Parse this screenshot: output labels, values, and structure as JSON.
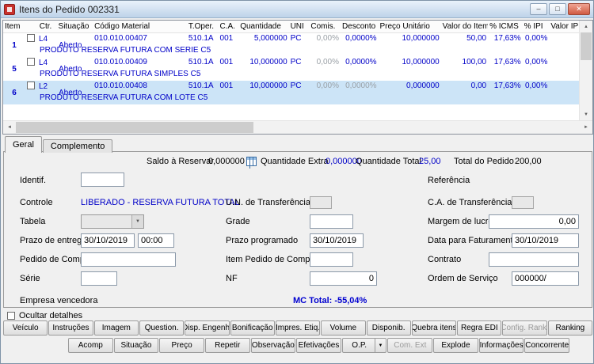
{
  "window": {
    "title": "Itens do Pedido 002331"
  },
  "icons": {
    "minimize": "–",
    "maximize": "□",
    "close": "✕",
    "scroll_up": "▲",
    "scroll_down": "▼",
    "scroll_left": "◄",
    "scroll_right": "►",
    "dropdown": "▼"
  },
  "colors": {
    "grid_text": "#0000C8",
    "selection_bg": "#CCE4F7",
    "muted_text": "#9AA0A6",
    "highlight_blue": "#0000D0"
  },
  "grid": {
    "columns": [
      "Item",
      "Ctr.",
      "Situação",
      "Código Material",
      "T.Oper.",
      "C.A.",
      "Quantidade",
      "UNI",
      "Comis.",
      "Desconto",
      "Preço Unitário",
      "Valor do Item",
      "% ICMS",
      "% IPI",
      "Valor IPI"
    ],
    "rows": [
      {
        "item": "1",
        "ctr": "L4",
        "situacao": "Aberto",
        "codigo": "010.010.00407",
        "toper": "510.1A",
        "ca": "001",
        "quantidade": "5,000000",
        "uni": "PC",
        "comis": "0,00%",
        "desconto": "0,0000%",
        "preco": "10,000000",
        "valor": "50,00",
        "icms": "17,63%",
        "ipi": "0,00%",
        "descricao": "PRODUTO RESERVA FUTURA COM SERIE C5"
      },
      {
        "item": "5",
        "ctr": "L4",
        "situacao": "Aberto",
        "codigo": "010.010.00409",
        "toper": "510.1A",
        "ca": "001",
        "quantidade": "10,000000",
        "uni": "PC",
        "comis": "0,00%",
        "desconto": "0,0000%",
        "preco": "10,000000",
        "valor": "100,00",
        "icms": "17,63%",
        "ipi": "0,00%",
        "descricao": "PRODUTO RESERVA FUTURA SIMPLES C5"
      },
      {
        "item": "6",
        "ctr": "L2",
        "situacao": "Aberto",
        "codigo": "010.010.00408",
        "toper": "510.1A",
        "ca": "001",
        "quantidade": "10,000000",
        "uni": "PC",
        "comis": "0,00%",
        "desconto": "0,0000%",
        "preco": "0,000000",
        "valor": "0,00",
        "icms": "17,63%",
        "ipi": "0,00%",
        "descricao": "PRODUTO RESERVA FUTURA COM LOTE C5"
      }
    ]
  },
  "tabs": {
    "geral": "Geral",
    "complemento": "Complemento"
  },
  "summary": {
    "saldo_label": "Saldo à Reservar",
    "saldo_value": "0,000000",
    "extra_label": "Quantidade Extra",
    "extra_value": "0,000000",
    "total_qtd_label": "Quantidade Total",
    "total_qtd_value": "25,00",
    "total_pedido_label": "Total do Pedido",
    "total_pedido_value": "200,00"
  },
  "form": {
    "identif_label": "Identif.",
    "referencia_label": "Referência",
    "controle_label": "Controle",
    "controle_value": "LIBERADO - RESERVA FUTURA TOTAL",
    "un_transf_label": "U.N. de Transferência",
    "ca_transf_label": "C.A. de Transferência",
    "tabela_label": "Tabela",
    "grade_label": "Grade",
    "margem_label": "Margem de lucro",
    "margem_value": "0,00",
    "prazo_entrega_label": "Prazo de entrega",
    "prazo_entrega_date": "30/10/2019",
    "prazo_entrega_time": "00:00",
    "prazo_prog_label": "Prazo programado",
    "prazo_prog_value": "30/10/2019",
    "data_fat_label": "Data para Faturamento",
    "data_fat_value": "30/10/2019",
    "pedido_compra_label": "Pedido de Compra",
    "item_pedido_label": "Item Pedido de Compra",
    "contrato_label": "Contrato",
    "serie_label": "Série",
    "nf_label": "NF",
    "nf_value": "0",
    "os_label": "Ordem de Serviço",
    "os_value": "000000/",
    "empresa_label": "Empresa vencedora",
    "mc_total": "MC Total: -55,04%"
  },
  "footer": {
    "ocultar_label": "Ocultar detalhes"
  },
  "buttons": {
    "row1": [
      {
        "label": "Veículo"
      },
      {
        "label": "Instruções"
      },
      {
        "label": "Imagem"
      },
      {
        "label": "Question."
      },
      {
        "label": "Disp. Engenh."
      },
      {
        "label": "Bonificação"
      },
      {
        "label": "Impres. Etiq."
      },
      {
        "label": "Volume"
      },
      {
        "label": "Disponib."
      },
      {
        "label": "Quebra itens"
      },
      {
        "label": "Regra EDI"
      },
      {
        "label": "Config. Rank.",
        "disabled": true
      },
      {
        "label": "Ranking"
      }
    ],
    "row2": [
      {
        "label": "Acomp"
      },
      {
        "label": "Situação"
      },
      {
        "label": "Preço"
      },
      {
        "label": "Repetir"
      },
      {
        "label": "Observação"
      },
      {
        "label": "Efetivações"
      },
      {
        "label": "O.P.",
        "split": true
      },
      {
        "label": "Com. Ext",
        "disabled": true
      },
      {
        "label": "Explode"
      },
      {
        "label": "Informações"
      },
      {
        "label": "Concorrente"
      }
    ]
  }
}
